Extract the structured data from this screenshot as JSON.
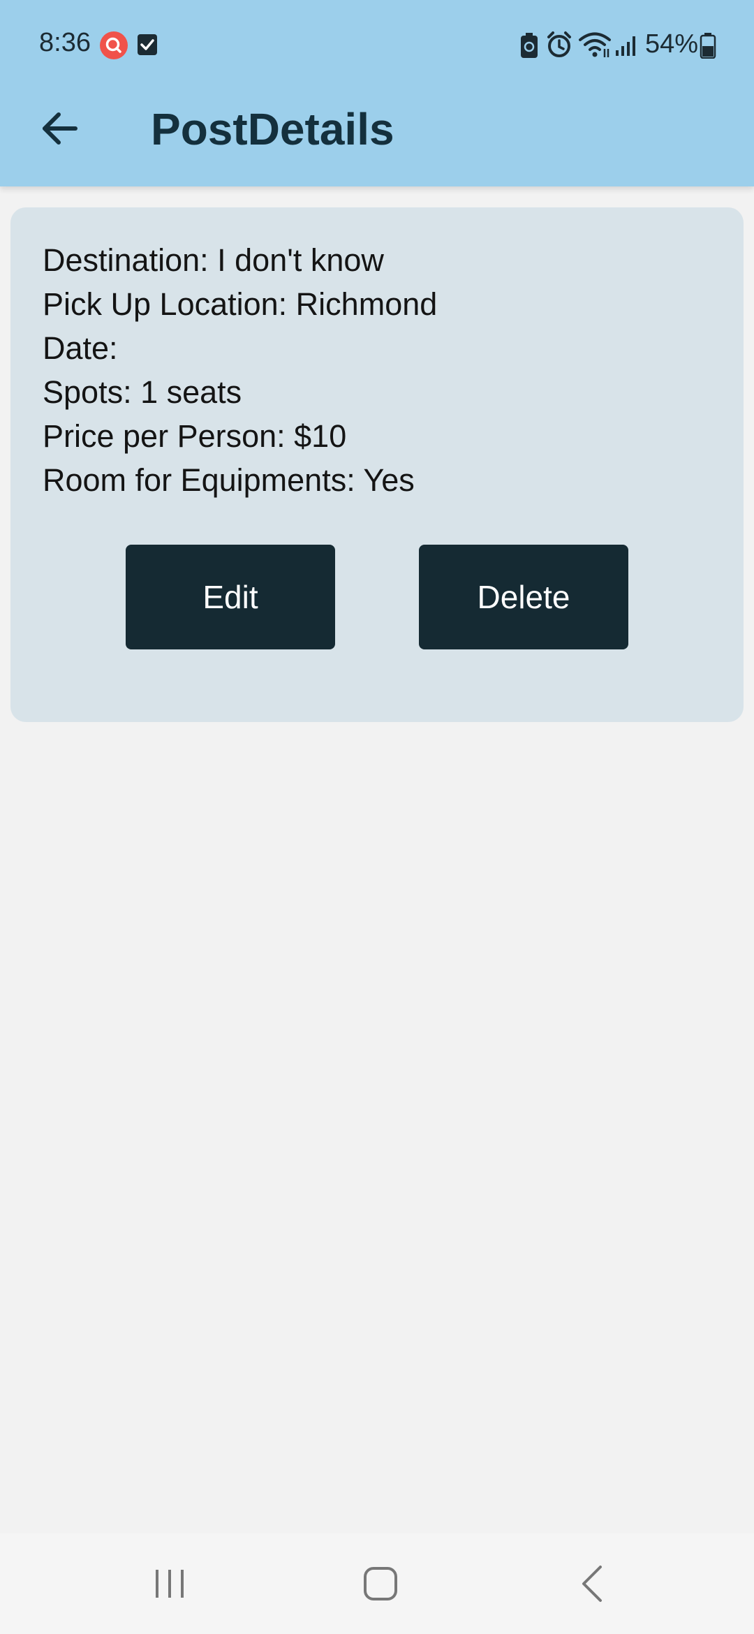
{
  "status_bar": {
    "time": "8:36",
    "battery_percent": "54%",
    "icons": [
      "search-notification-icon",
      "checkbox-notification-icon",
      "battery-saver-icon",
      "alarm-icon",
      "wifi-icon",
      "signal-icon",
      "battery-icon"
    ]
  },
  "app_bar": {
    "title": "PostDetails",
    "back_icon": "arrow-left-icon"
  },
  "post": {
    "destination": "Destination: I don't know",
    "pickup": "Pick Up Location: Richmond",
    "date": "Date:",
    "spots": "Spots: 1 seats",
    "price": "Price per Person: $10",
    "equipment": "Room for Equipments: Yes"
  },
  "actions": {
    "edit_label": "Edit",
    "delete_label": "Delete"
  },
  "nav_bar": {
    "icons": [
      "recents-icon",
      "home-icon",
      "back-icon"
    ]
  },
  "colors": {
    "app_bar": "#9ccfeb",
    "card": "#d8e3e9",
    "button": "#152a33",
    "background": "#f2f2f2",
    "notification_badge": "#f0524a"
  }
}
